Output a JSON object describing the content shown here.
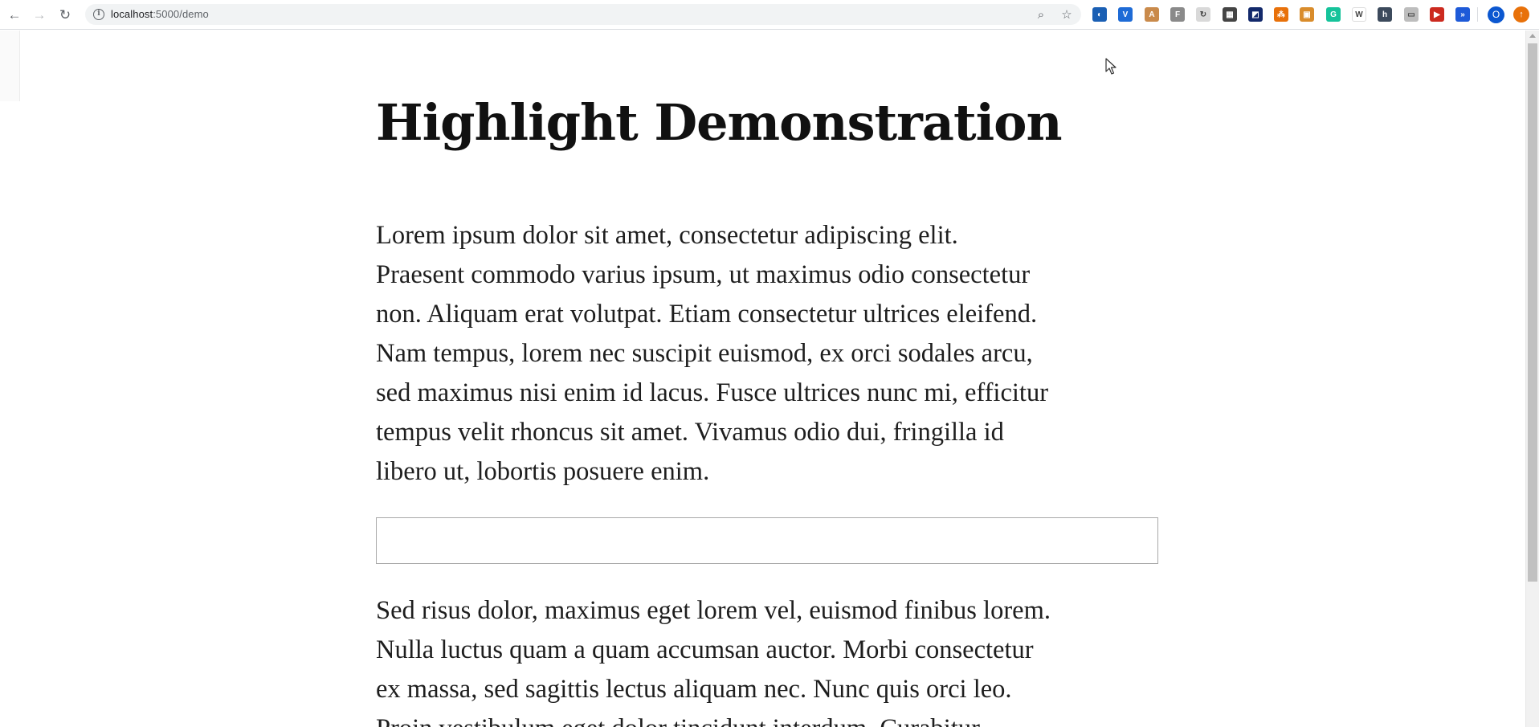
{
  "browser": {
    "url_host": "localhost",
    "url_path": ":5000/demo",
    "profile_initial": "O",
    "extensions": [
      {
        "name": "compass-ext-icon",
        "color": "#1a5fb4",
        "glyph": "◐"
      },
      {
        "name": "v-ext-icon",
        "color": "#1e6bd6",
        "glyph": "V"
      },
      {
        "name": "pdf-ext-icon",
        "color": "#c98a4b",
        "glyph": "A"
      },
      {
        "name": "f-ext-icon",
        "color": "#8a8a8a",
        "glyph": "F"
      },
      {
        "name": "sync-ext-icon",
        "color": "#d9d9d9",
        "glyph": "↻"
      },
      {
        "name": "grid-ext-icon",
        "color": "#444444",
        "glyph": "▦"
      },
      {
        "name": "flag-ext-icon",
        "color": "#13296b",
        "glyph": "◩"
      },
      {
        "name": "network-ext-icon",
        "color": "#e8710a",
        "glyph": "⁂"
      },
      {
        "name": "image-ext-icon",
        "color": "#d98c2b",
        "glyph": "▣"
      },
      {
        "name": "grammarly-ext-icon",
        "color": "#15c39a",
        "glyph": "G"
      },
      {
        "name": "wikipedia-ext-icon",
        "color": "#ffffff",
        "glyph": "W"
      },
      {
        "name": "h-ext-icon",
        "color": "#3c4a5c",
        "glyph": "h"
      },
      {
        "name": "box-ext-icon",
        "color": "#bdbdbd",
        "glyph": "▭"
      },
      {
        "name": "youtube-ext-icon",
        "color": "#cc2a1f",
        "glyph": "▶"
      },
      {
        "name": "forward-ext-icon",
        "color": "#1e5ad8",
        "glyph": "»"
      }
    ]
  },
  "page": {
    "title": "Highlight Demonstration",
    "paragraph_1": [
      "Lorem ipsum dolor sit amet, consectetur adipiscing elit.",
      "Praesent commodo varius ipsum, ut maximus odio consectetur",
      "non. Aliquam erat volutpat. Etiam consectetur ultrices eleifend.",
      "Nam tempus, lorem nec suscipit euismod, ex orci sodales arcu,",
      "sed maximus nisi enim id lacus. Fusce ultrices nunc mi, efficitur",
      "tempus velit rhoncus sit amet. Vivamus odio dui, fringilla id",
      "libero ut, lobortis posuere enim."
    ],
    "text_box_value": "",
    "paragraph_2": [
      "Sed risus dolor, maximus eget lorem vel, euismod finibus lorem.",
      "Nulla luctus quam a quam accumsan auctor. Morbi consectetur",
      "ex massa, sed sagittis lectus aliquam nec. Nunc quis orci leo.",
      "Proin vestibulum eget dolor tincidunt interdum. Curabitur"
    ]
  }
}
